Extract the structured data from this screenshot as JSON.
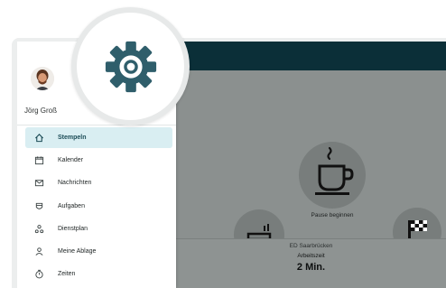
{
  "user": {
    "name": "Jörg Groß"
  },
  "sidebar": {
    "items": [
      {
        "label": "Stempeln",
        "icon": "home-icon",
        "active": true
      },
      {
        "label": "Kalender",
        "icon": "calendar-icon",
        "active": false
      },
      {
        "label": "Nachrichten",
        "icon": "mail-icon",
        "active": false
      },
      {
        "label": "Aufgaben",
        "icon": "tasks-icon",
        "active": false
      },
      {
        "label": "Dienstplan",
        "icon": "schedule-icon",
        "active": false
      },
      {
        "label": "Meine Ablage",
        "icon": "storage-icon",
        "active": false
      },
      {
        "label": "Zeiten",
        "icon": "timer-icon",
        "active": false
      }
    ]
  },
  "main": {
    "pause_label": "Pause beginnen",
    "location": "ED Saarbrücken",
    "work_label": "Arbeitszeit",
    "work_time": "2 Min."
  },
  "colors": {
    "header": "#0b2f38",
    "accent": "#1c4c57",
    "active_bg": "#d9eef2",
    "gear": "#2f5e6b"
  }
}
